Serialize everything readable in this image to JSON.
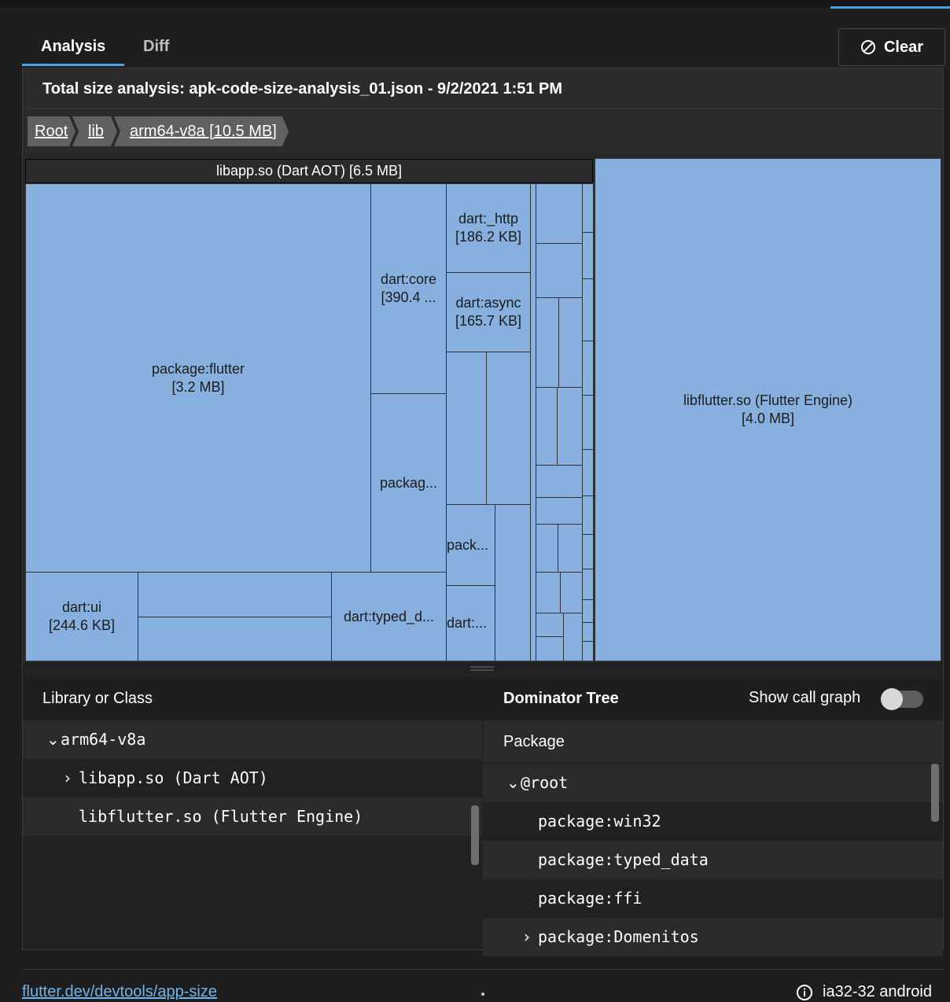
{
  "tabs": [
    {
      "label": "Analysis",
      "active": true
    },
    {
      "label": "Diff",
      "active": false
    }
  ],
  "clear_button": {
    "label": "Clear",
    "icon": "block-icon"
  },
  "analysis_title": "Total size analysis: apk-code-size-analysis_01.json - 9/2/2021 1:51 PM",
  "breadcrumbs": [
    "Root",
    "lib",
    "arm64-v8a [10.5 MB]"
  ],
  "treemap": {
    "libapp_header": "libapp.so (Dart AOT) [6.5 MB]",
    "package_flutter": "package:flutter\n[3.2 MB]",
    "dart_core": "dart:core\n[390.4 ...",
    "dart_http": "dart:_http\n[186.2 KB]",
    "dart_async": "dart:async\n[165.7 KB]",
    "package_truncated": "packag...",
    "pack_truncated": "pack...",
    "dart_truncated": "dart:...",
    "dart_ui": "dart:ui\n[244.6 KB]",
    "dart_typed": "dart:typed_d...",
    "libflutter": "libflutter.so (Flutter Engine)\n[4.0 MB]"
  },
  "library_table": {
    "header": "Library or Class",
    "rows": [
      {
        "label": "arm64-v8a",
        "expander": "⌄"
      },
      {
        "label": "libapp.so (Dart AOT)",
        "expander": "›"
      },
      {
        "label": "libflutter.so (Flutter Engine)",
        "expander": ""
      }
    ]
  },
  "dominator_tree": {
    "header": "Dominator Tree",
    "show_call_graph_label": "Show call graph",
    "show_call_graph": false,
    "column_header": "Package",
    "rows": [
      {
        "label": "@root",
        "expander": "⌄"
      },
      {
        "label": "package:win32",
        "expander": ""
      },
      {
        "label": "package:typed_data",
        "expander": ""
      },
      {
        "label": "package:ffi",
        "expander": ""
      },
      {
        "label": "package:Domenitos",
        "expander": "›"
      }
    ]
  },
  "footer": {
    "link": "flutter.dev/devtools/app-size",
    "info_icon": "info-icon",
    "platform": "ia32-32 android"
  },
  "colors": {
    "treemap_node": "#87b0de",
    "accent": "#4aa3e8",
    "background": "#1e1e1f"
  }
}
